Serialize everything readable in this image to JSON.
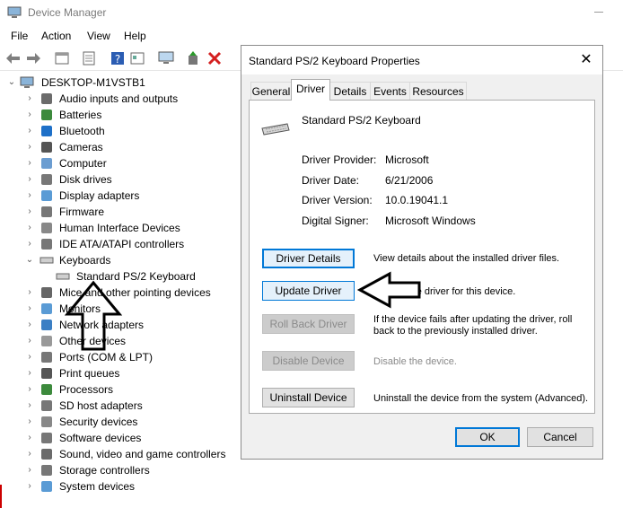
{
  "window": {
    "title": "Device Manager"
  },
  "menu": [
    "File",
    "Action",
    "View",
    "Help"
  ],
  "tree": {
    "root": "DESKTOP-M1VSTB1",
    "items": [
      "Audio inputs and outputs",
      "Batteries",
      "Bluetooth",
      "Cameras",
      "Computer",
      "Disk drives",
      "Display adapters",
      "Firmware",
      "Human Interface Devices",
      "IDE ATA/ATAPI controllers",
      "Keyboards",
      "Standard PS/2 Keyboard",
      "Mice and other pointing devices",
      "Monitors",
      "Network adapters",
      "Other devices",
      "Ports (COM & LPT)",
      "Print queues",
      "Processors",
      "SD host adapters",
      "Security devices",
      "Software devices",
      "Sound, video and game controllers",
      "Storage controllers",
      "System devices"
    ]
  },
  "dialog": {
    "title": "Standard PS/2 Keyboard Properties",
    "close": "✕",
    "tabs": [
      "General",
      "Driver",
      "Details",
      "Events",
      "Resources"
    ],
    "device_name": "Standard PS/2 Keyboard",
    "provider_label": "Driver Provider:",
    "provider": "Microsoft",
    "date_label": "Driver Date:",
    "date": "6/21/2006",
    "version_label": "Driver Version:",
    "version": "10.0.19041.1",
    "signer_label": "Digital Signer:",
    "signer": "Microsoft Windows",
    "driver_details": "Driver Details",
    "driver_details_desc": "View details about the installed driver files.",
    "update_driver": "Update Driver",
    "update_driver_desc": "Update the driver for this device.",
    "rollback": "Roll Back Driver",
    "rollback_desc": "If the device fails after updating the driver, roll back to the previously installed driver.",
    "disable": "Disable Device",
    "disable_desc": "Disable the device.",
    "uninstall": "Uninstall Device",
    "uninstall_desc": "Uninstall the device from the system (Advanced).",
    "ok": "OK",
    "cancel": "Cancel"
  }
}
